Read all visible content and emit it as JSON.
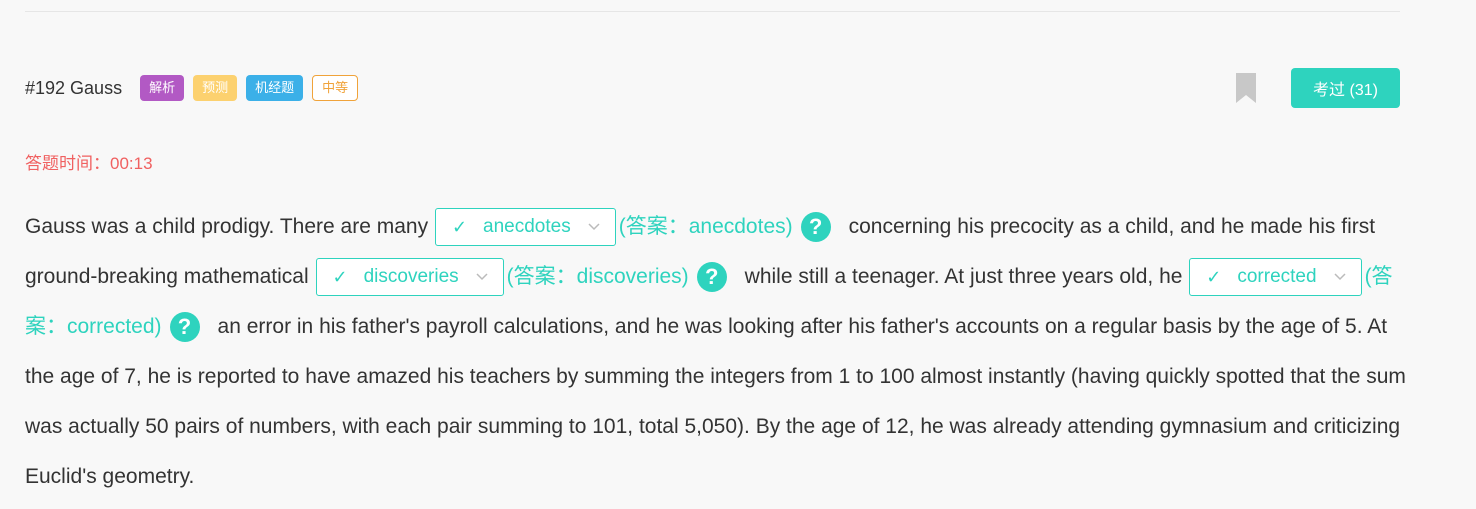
{
  "question": {
    "title": "#192 Gauss",
    "tags": [
      "解析",
      "预测",
      "机经题",
      "中等"
    ],
    "taken_button": "考过 (31)",
    "timer_label": "答题时间：",
    "timer_value": "00:13"
  },
  "passage": {
    "seg1": "Gauss was a child prodigy. There are many",
    "blank1_value": "anecdotes",
    "answer1": "(答案：anecdotes)",
    "seg2": "concerning his precocity as a child, and he made his first ground-breaking mathematical",
    "blank2_value": "discoveries",
    "answer2": "(答案：discoveries)",
    "seg3": "while still a teenager. At just three years old, he",
    "blank3_value": "corrected",
    "answer3": "(答案：corrected)",
    "seg4": "an error in his father's payroll calculations, and he was looking after his father's accounts on a regular basis by the age of 5. At the age of 7, he is reported to have amazed his teachers by summing the integers from 1 to 100 almost instantly (having quickly spotted that the sum was actually 50 pairs of numbers, with each pair summing to 101, total 5,050). By the age of 12, he was already attending gymnasium and criticizing Euclid's geometry."
  },
  "icons": {
    "check": "✓",
    "help": "?"
  },
  "colors": {
    "accent": "#2ed3be",
    "timer": "#f06060",
    "tag_jiexi": "#b259c4",
    "tag_yuce": "#fcd16f",
    "tag_jijing": "#3bb0e8",
    "tag_level": "#f0a33a"
  }
}
